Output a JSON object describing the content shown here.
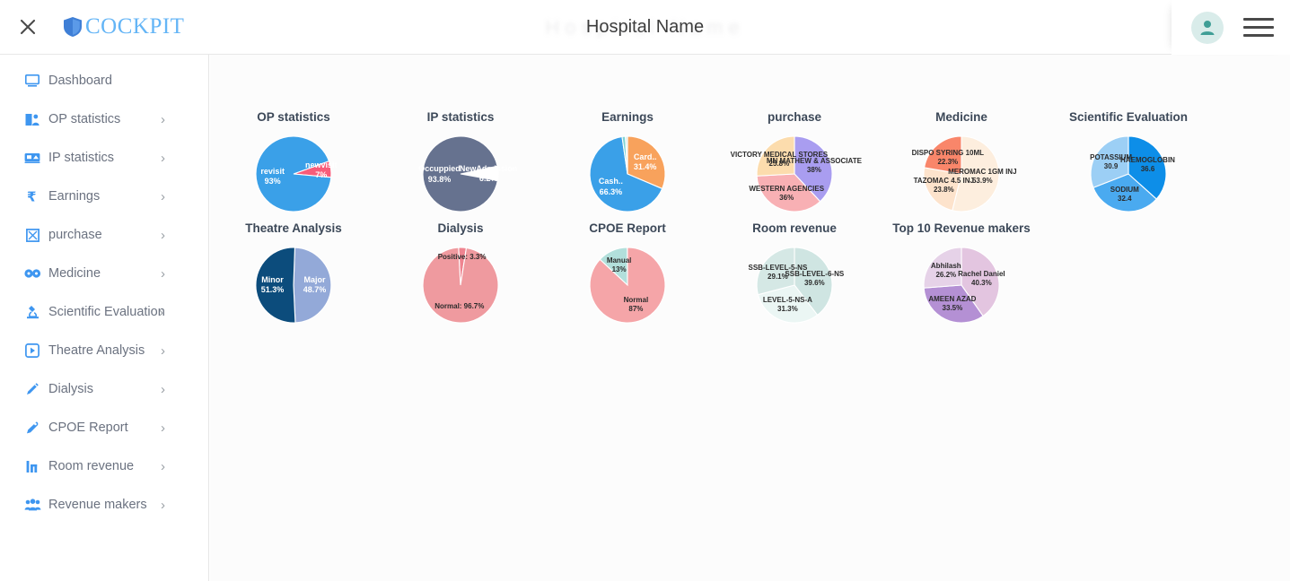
{
  "topbar": {
    "close_icon": "close-icon",
    "brand_text": "COCKPIT",
    "brand_icon": "shield-icon",
    "title": "Hospital Name",
    "watermark": "Hospital Name",
    "avatar_icon": "user-avatar-icon",
    "menu_icon": "hamburger-menu-icon"
  },
  "sidebar": {
    "items": [
      {
        "label": "Dashboard",
        "icon": "monitor-icon",
        "chevron": ""
      },
      {
        "label": "OP statistics",
        "icon": "people-icon",
        "chevron": "›"
      },
      {
        "label": "IP statistics",
        "icon": "bed-icon",
        "chevron": "›"
      },
      {
        "label": "Earnings",
        "icon": "rupee-icon",
        "chevron": "›"
      },
      {
        "label": "purchase",
        "icon": "box-icon",
        "chevron": "›"
      },
      {
        "label": "Medicine",
        "icon": "pills-icon",
        "chevron": "›"
      },
      {
        "label": "Scientific Evaluation",
        "icon": "microscope-icon",
        "chevron": "›"
      },
      {
        "label": "Theatre Analysis",
        "icon": "theatre-icon",
        "chevron": "›"
      },
      {
        "label": "Dialysis",
        "icon": "syringe-icon",
        "chevron": "›"
      },
      {
        "label": "CPOE Report",
        "icon": "pen-icon",
        "chevron": "›"
      },
      {
        "label": "Room revenue",
        "icon": "bar-chart-icon",
        "chevron": "›"
      },
      {
        "label": "Revenue makers",
        "icon": "users-icon",
        "chevron": "›"
      }
    ]
  },
  "chart_data": [
    {
      "type": "pie",
      "title": "OP statistics",
      "labels": [
        "newvisit",
        "revisit"
      ],
      "values": [
        7.0,
        93.0
      ],
      "value_suffix": "%",
      "colors": [
        "#f75c7a",
        "#3aa0e8"
      ],
      "label_style": "inside-white",
      "start_angle": -20
    },
    {
      "type": "pie",
      "title": "IP statistics",
      "labels": [
        "NewAdmission",
        "Occuppied"
      ],
      "values": [
        6.2,
        93.8
      ],
      "value_suffix": "%",
      "colors": [
        "#ffffff",
        "#66728f"
      ],
      "label_style": "inside-white",
      "start_angle": -12
    },
    {
      "type": "pie",
      "title": "Earnings",
      "labels": [
        "Card..",
        "Cash..",
        "",
        ""
      ],
      "values": [
        31.4,
        66.3,
        1.4,
        0.9
      ],
      "value_suffix": "%",
      "colors": [
        "#f8a25c",
        "#3aa0e8",
        "#7fd4d4",
        "#cfeceb"
      ],
      "label_style": "inside-white",
      "start_angle": -90
    },
    {
      "type": "pie",
      "title": "purchase",
      "labels": [
        "MN MATHEW & ASSOCIATE",
        "WESTERN AGENCIES",
        "VICTORY MEDICAL STORES"
      ],
      "values": [
        38.0,
        36.0,
        25.8
      ],
      "value_suffix": "%",
      "colors": [
        "#a99df0",
        "#f8b0b4",
        "#fcdcad"
      ],
      "label_style": "inside-dark",
      "start_angle": -90
    },
    {
      "type": "pie",
      "title": "Medicine",
      "labels": [
        "MEROMAC 1GM INJ",
        "TAZOMAC 4.5 INJ",
        "DISPO SYRING 10ML"
      ],
      "values": [
        53.9,
        23.8,
        22.3
      ],
      "value_suffix": "%",
      "colors": [
        "#fdeede",
        "#fde3cc",
        "#f9866a"
      ],
      "label_style": "inside-dark",
      "start_angle": -90
    },
    {
      "type": "pie",
      "title": "Scientific Evaluation",
      "labels": [
        "HAEMOGLOBIN",
        "SODIUM",
        "POTASSIUM"
      ],
      "values": [
        36.6,
        32.4,
        30.9
      ],
      "value_suffix": "",
      "colors": [
        "#0d8ee8",
        "#4aaaf0",
        "#9ccff5"
      ],
      "label_style": "inside-dark",
      "start_angle": -90
    },
    {
      "type": "pie",
      "title": "Theatre Analysis",
      "labels": [
        "Major",
        "Minor"
      ],
      "values": [
        48.7,
        51.3
      ],
      "value_suffix": "%",
      "colors": [
        "#93a9d8",
        "#0c4c7c"
      ],
      "label_style": "inside-white",
      "start_angle": -88
    },
    {
      "type": "pie",
      "title": "Dialysis",
      "labels": [
        "Positive:",
        "Normal:"
      ],
      "values": [
        3.3,
        96.7
      ],
      "value_suffix": "%",
      "colors": [
        "#ef8490",
        "#ef9a9f"
      ],
      "label_style": "inside-dark-inline",
      "start_angle": -93
    },
    {
      "type": "pie",
      "title": "CPOE Report",
      "labels": [
        "Manual",
        "Normal"
      ],
      "values": [
        13.0,
        87.0
      ],
      "value_suffix": "%",
      "colors": [
        "#b2dfdb",
        "#f5a5a8"
      ],
      "label_style": "inside-dark",
      "start_angle": -137
    },
    {
      "type": "pie",
      "title": "Room revenue",
      "labels": [
        "SSB-LEVEL-6-NS",
        "LEVEL-5-NS-A",
        "SSB-LEVEL-5-NS"
      ],
      "values": [
        39.6,
        31.3,
        29.1
      ],
      "value_suffix": "%",
      "colors": [
        "#cfe5e2",
        "#ebf6f4",
        "#d5e8e5"
      ],
      "label_style": "inside-dark",
      "start_angle": -90
    },
    {
      "type": "pie",
      "title": "Top 10 Revenue makers",
      "labels": [
        "Rachel Daniel",
        "AMEEN AZAD",
        "Abhilash"
      ],
      "values": [
        40.3,
        33.5,
        26.2
      ],
      "value_suffix": "%",
      "colors": [
        "#e3c5e0",
        "#b490d4",
        "#e6d2e8"
      ],
      "label_style": "inside-dark",
      "start_angle": -90
    }
  ]
}
